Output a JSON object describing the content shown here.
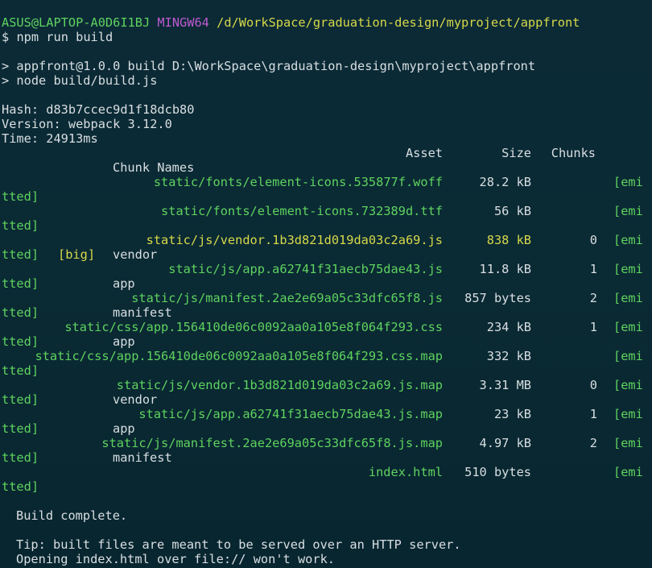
{
  "prompt": {
    "user_host": "ASUS@LAPTOP-A0D6I1BJ",
    "system": "MINGW64",
    "path": "/d/WorkSpace/graduation-design/myproject/appfront",
    "symbol": "$",
    "command": "npm run build"
  },
  "npm_output": {
    "line1": "> appfront@1.0.0 build D:\\WorkSpace\\graduation-design\\myproject\\appfront",
    "line2": "> node build/build.js"
  },
  "stats": {
    "hash": "Hash: d83b7ccec9d1f18dcb80",
    "version": "Version: webpack 3.12.0",
    "time": "Time: 24913ms"
  },
  "table": {
    "headers": {
      "asset": "Asset",
      "size": "Size",
      "chunks": "Chunks",
      "chunk_names": "Chunk Names"
    },
    "wrap_tail": "tted]",
    "rows": [
      {
        "asset": "static/fonts/element-icons.535877f.woff",
        "size": "28.2 kB",
        "chunk": "",
        "emitted": "[emi",
        "big": "",
        "names": ""
      },
      {
        "asset": "static/fonts/element-icons.732389d.ttf",
        "size": "56 kB",
        "chunk": "",
        "emitted": "[emi",
        "big": "",
        "names": ""
      },
      {
        "asset": "static/js/vendor.1b3d821d019da03c2a69.js",
        "size": "838 kB",
        "chunk": "0",
        "emitted": "[emi",
        "big": "[big]",
        "names": "vendor"
      },
      {
        "asset": "static/js/app.a62741f31aecb75dae43.js",
        "size": "11.8 kB",
        "chunk": "1",
        "emitted": "[emi",
        "big": "",
        "names": "app"
      },
      {
        "asset": "static/js/manifest.2ae2e69a05c33dfc65f8.js",
        "size": "857 bytes",
        "chunk": "2",
        "emitted": "[emi",
        "big": "",
        "names": "manifest"
      },
      {
        "asset": "static/css/app.156410de06c0092aa0a105e8f064f293.css",
        "size": "234 kB",
        "chunk": "1",
        "emitted": "[emi",
        "big": "",
        "names": "app"
      },
      {
        "asset": "static/css/app.156410de06c0092aa0a105e8f064f293.css.map",
        "size": "332 kB",
        "chunk": "",
        "emitted": "[emi",
        "big": "",
        "names": ""
      },
      {
        "asset": "static/js/vendor.1b3d821d019da03c2a69.js.map",
        "size": "3.31 MB",
        "chunk": "0",
        "emitted": "[emi",
        "big": "",
        "names": "vendor"
      },
      {
        "asset": "static/js/app.a62741f31aecb75dae43.js.map",
        "size": "23 kB",
        "chunk": "1",
        "emitted": "[emi",
        "big": "",
        "names": "app"
      },
      {
        "asset": "static/js/manifest.2ae2e69a05c33dfc65f8.js.map",
        "size": "4.97 kB",
        "chunk": "2",
        "emitted": "[emi",
        "big": "",
        "names": "manifest"
      },
      {
        "asset": "index.html",
        "size": "510 bytes",
        "chunk": "",
        "emitted": "[emi",
        "big": "",
        "names": ""
      }
    ]
  },
  "footer": {
    "build_complete": "Build complete.",
    "tip1": "Tip: built files are meant to be served over an HTTP server.",
    "tip2": "Opening index.html over file:// won't work."
  },
  "colors": {
    "background": "#0a2a34",
    "text": "#d9dfe2",
    "green": "#5fd35f",
    "yellow": "#d8d94a",
    "magenta": "#c05ad0"
  }
}
